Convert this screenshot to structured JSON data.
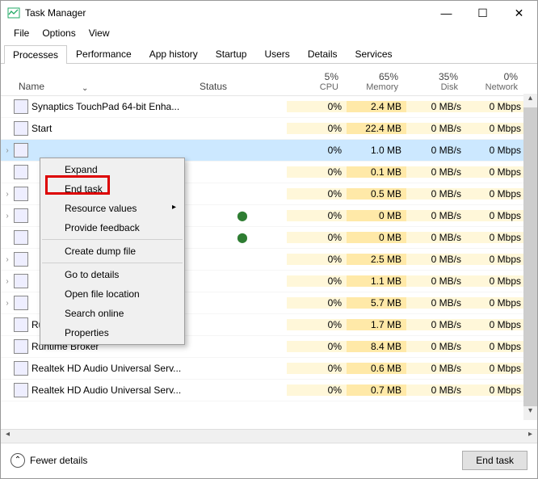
{
  "window": {
    "title": "Task Manager",
    "min": "—",
    "max": "☐",
    "close": "✕"
  },
  "menu": {
    "file": "File",
    "options": "Options",
    "view": "View"
  },
  "tabs": [
    "Processes",
    "Performance",
    "App history",
    "Startup",
    "Users",
    "Details",
    "Services"
  ],
  "active_tab": 0,
  "columns": {
    "name": "Name",
    "status": "Status",
    "cpu": {
      "pct": "5%",
      "label": "CPU"
    },
    "memory": {
      "pct": "65%",
      "label": "Memory"
    },
    "disk": {
      "pct": "35%",
      "label": "Disk"
    },
    "network": {
      "pct": "0%",
      "label": "Network"
    }
  },
  "processes": [
    {
      "expand": false,
      "name": "Synaptics TouchPad 64-bit Enha...",
      "status": "",
      "cpu": "0%",
      "mem": "2.4 MB",
      "disk": "0 MB/s",
      "net": "0 Mbps",
      "selected": false
    },
    {
      "expand": false,
      "name": "Start",
      "status": "",
      "cpu": "0%",
      "mem": "22.4 MB",
      "disk": "0 MB/s",
      "net": "0 Mbps",
      "selected": false
    },
    {
      "expand": true,
      "name": " ",
      "status": "",
      "cpu": "0%",
      "mem": "1.0 MB",
      "disk": "0 MB/s",
      "net": "0 Mbps",
      "selected": true
    },
    {
      "expand": false,
      "name": "",
      "status": "",
      "cpu": "0%",
      "mem": "0.1 MB",
      "disk": "0 MB/s",
      "net": "0 Mbps",
      "selected": false
    },
    {
      "expand": true,
      "name": "",
      "status": "",
      "cpu": "0%",
      "mem": "0.5 MB",
      "disk": "0 MB/s",
      "net": "0 Mbps",
      "selected": false
    },
    {
      "expand": true,
      "name": "",
      "status": "leaf",
      "cpu": "0%",
      "mem": "0 MB",
      "disk": "0 MB/s",
      "net": "0 Mbps",
      "selected": false
    },
    {
      "expand": false,
      "name": "",
      "status": "leaf",
      "cpu": "0%",
      "mem": "0 MB",
      "disk": "0 MB/s",
      "net": "0 Mbps",
      "selected": false
    },
    {
      "expand": true,
      "name": "",
      "status": "",
      "cpu": "0%",
      "mem": "2.5 MB",
      "disk": "0 MB/s",
      "net": "0 Mbps",
      "selected": false
    },
    {
      "expand": true,
      "name": "",
      "status": "",
      "cpu": "0%",
      "mem": "1.1 MB",
      "disk": "0 MB/s",
      "net": "0 Mbps",
      "selected": false
    },
    {
      "expand": true,
      "name": "",
      "status": "",
      "cpu": "0%",
      "mem": "5.7 MB",
      "disk": "0 MB/s",
      "net": "0 Mbps",
      "selected": false
    },
    {
      "expand": false,
      "name": "Runtime Broker",
      "status": "",
      "cpu": "0%",
      "mem": "1.7 MB",
      "disk": "0 MB/s",
      "net": "0 Mbps",
      "selected": false
    },
    {
      "expand": false,
      "name": "Runtime Broker",
      "status": "",
      "cpu": "0%",
      "mem": "8.4 MB",
      "disk": "0 MB/s",
      "net": "0 Mbps",
      "selected": false
    },
    {
      "expand": false,
      "name": "Realtek HD Audio Universal Serv...",
      "status": "",
      "cpu": "0%",
      "mem": "0.6 MB",
      "disk": "0 MB/s",
      "net": "0 Mbps",
      "selected": false
    },
    {
      "expand": false,
      "name": "Realtek HD Audio Universal Serv...",
      "status": "",
      "cpu": "0%",
      "mem": "0.7 MB",
      "disk": "0 MB/s",
      "net": "0 Mbps",
      "selected": false
    }
  ],
  "context_menu": [
    {
      "label": "Expand",
      "sep": false,
      "sub": false
    },
    {
      "label": "End task",
      "sep": false,
      "sub": false
    },
    {
      "label": "Resource values",
      "sep": false,
      "sub": true
    },
    {
      "label": "Provide feedback",
      "sep": false,
      "sub": false
    },
    {
      "label": "Create dump file",
      "sep": true,
      "sub": false
    },
    {
      "label": "Go to details",
      "sep": true,
      "sub": false
    },
    {
      "label": "Open file location",
      "sep": false,
      "sub": false
    },
    {
      "label": "Search online",
      "sep": false,
      "sub": false
    },
    {
      "label": "Properties",
      "sep": false,
      "sub": false
    }
  ],
  "footer": {
    "fewer": "Fewer details",
    "endtask": "End task"
  }
}
